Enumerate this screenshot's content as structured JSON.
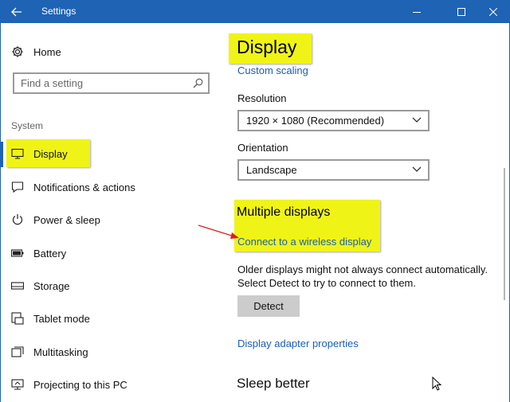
{
  "window": {
    "title": "Settings",
    "accent_color": "#1e63b4",
    "highlight_color": "#f0f416"
  },
  "titlebar": {
    "back_icon": "back-arrow-icon",
    "minimize_icon": "minimize-icon",
    "maximize_icon": "maximize-icon",
    "close_icon": "close-icon"
  },
  "sidebar": {
    "home_label": "Home",
    "search": {
      "placeholder": "Find a setting"
    },
    "section_label": "System",
    "items": [
      {
        "label": "Display",
        "icon": "monitor-icon",
        "active": true
      },
      {
        "label": "Notifications & actions",
        "icon": "notification-icon"
      },
      {
        "label": "Power & sleep",
        "icon": "power-icon"
      },
      {
        "label": "Battery",
        "icon": "battery-icon"
      },
      {
        "label": "Storage",
        "icon": "storage-icon"
      },
      {
        "label": "Tablet mode",
        "icon": "tablet-icon"
      },
      {
        "label": "Multitasking",
        "icon": "multitasking-icon"
      },
      {
        "label": "Projecting to this PC",
        "icon": "projecting-icon"
      }
    ]
  },
  "main": {
    "page_title": "Display",
    "custom_scaling_link": "Custom scaling",
    "resolution": {
      "label": "Resolution",
      "value": "1920 × 1080 (Recommended)"
    },
    "orientation": {
      "label": "Orientation",
      "value": "Landscape"
    },
    "multiple_displays": {
      "title": "Multiple displays",
      "wireless_link": "Connect to a wireless display",
      "description_line1": "Older displays might not always connect automatically.",
      "description_line2": "Select Detect to try to connect to them.",
      "detect_button": "Detect"
    },
    "adapter_link": "Display adapter properties",
    "sleep_title": "Sleep better"
  }
}
